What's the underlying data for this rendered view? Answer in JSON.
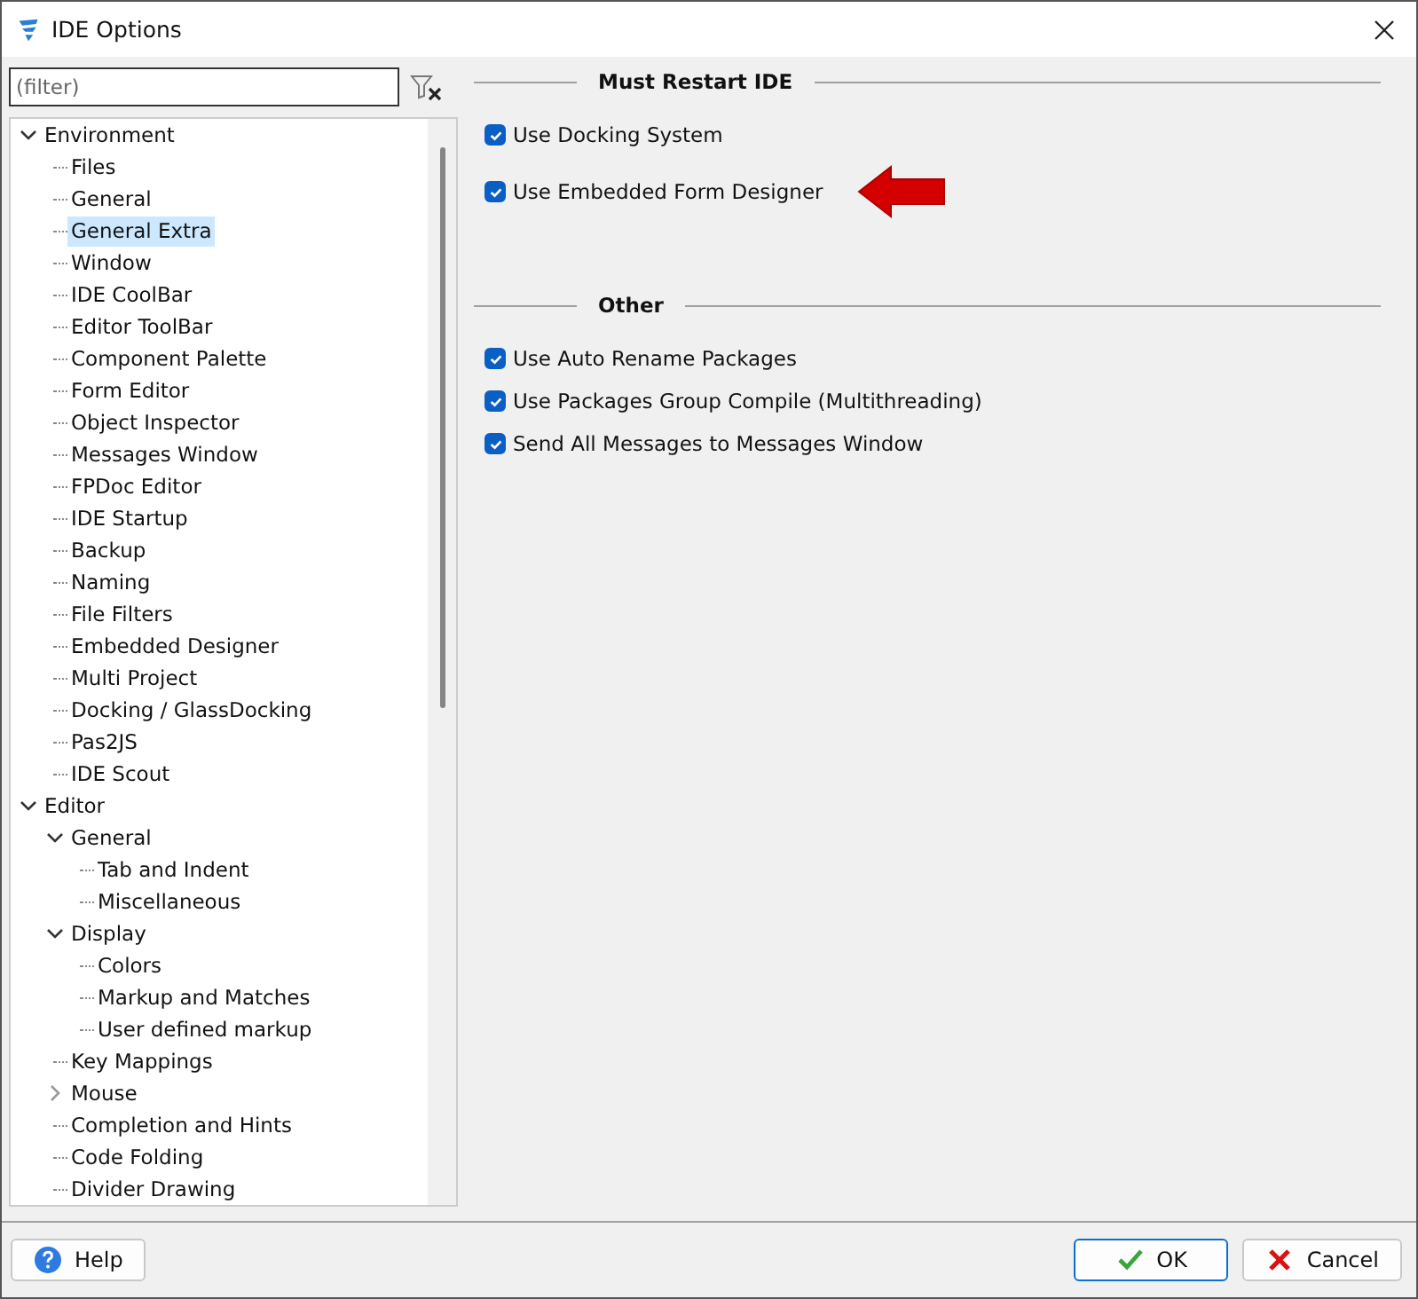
{
  "window": {
    "title": "IDE Options"
  },
  "filter": {
    "placeholder": "(filter)"
  },
  "tree": [
    {
      "label": "Environment",
      "expanded": true,
      "selected": false,
      "children": [
        {
          "label": "Files",
          "selected": false
        },
        {
          "label": "General",
          "selected": false
        },
        {
          "label": "General Extra",
          "selected": true
        },
        {
          "label": "Window",
          "selected": false
        },
        {
          "label": "IDE CoolBar",
          "selected": false
        },
        {
          "label": "Editor ToolBar",
          "selected": false
        },
        {
          "label": "Component Palette",
          "selected": false
        },
        {
          "label": "Form Editor",
          "selected": false
        },
        {
          "label": "Object Inspector",
          "selected": false
        },
        {
          "label": "Messages Window",
          "selected": false
        },
        {
          "label": "FPDoc Editor",
          "selected": false
        },
        {
          "label": "IDE Startup",
          "selected": false
        },
        {
          "label": "Backup",
          "selected": false
        },
        {
          "label": "Naming",
          "selected": false
        },
        {
          "label": "File Filters",
          "selected": false
        },
        {
          "label": "Embedded Designer",
          "selected": false
        },
        {
          "label": "Multi Project",
          "selected": false
        },
        {
          "label": "Docking / GlassDocking",
          "selected": false
        },
        {
          "label": "Pas2JS",
          "selected": false
        },
        {
          "label": "IDE Scout",
          "selected": false
        }
      ]
    },
    {
      "label": "Editor",
      "expanded": true,
      "selected": false,
      "children": [
        {
          "label": "General",
          "expanded": true,
          "selected": false,
          "children": [
            {
              "label": "Tab and Indent",
              "selected": false
            },
            {
              "label": "Miscellaneous",
              "selected": false
            }
          ]
        },
        {
          "label": "Display",
          "expanded": true,
          "selected": false,
          "children": [
            {
              "label": "Colors",
              "selected": false
            },
            {
              "label": "Markup and Matches",
              "selected": false
            },
            {
              "label": "User defined markup",
              "selected": false
            }
          ]
        },
        {
          "label": "Key Mappings",
          "selected": false
        },
        {
          "label": "Mouse",
          "expanded": false,
          "selected": false
        },
        {
          "label": "Completion and Hints",
          "selected": false
        },
        {
          "label": "Code Folding",
          "selected": false
        },
        {
          "label": "Divider Drawing",
          "selected": false
        }
      ]
    }
  ],
  "groups": [
    {
      "title": "Must Restart IDE",
      "options": [
        {
          "label": "Use Docking System",
          "checked": true
        },
        {
          "label": "Use Embedded Form Designer",
          "checked": true,
          "pointer": true
        }
      ]
    },
    {
      "title": "Other",
      "options": [
        {
          "label": "Use Auto Rename Packages",
          "checked": true
        },
        {
          "label": "Use Packages Group Compile (Multithreading)",
          "checked": true
        },
        {
          "label": "Send All Messages to Messages Window",
          "checked": true
        }
      ]
    }
  ],
  "buttons": [
    {
      "label": "Help",
      "kind": "help"
    },
    {
      "label": "OK",
      "kind": "ok"
    },
    {
      "label": "Cancel",
      "kind": "cancel"
    }
  ]
}
